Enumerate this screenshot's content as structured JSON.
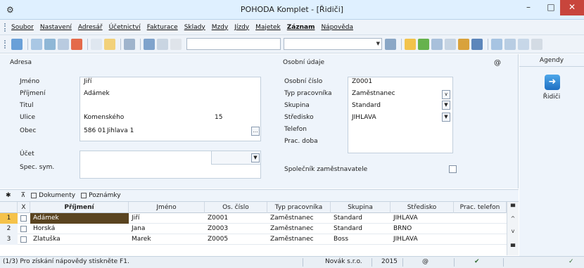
{
  "window": {
    "title": "POHODA Komplet - [Řidiči]",
    "minimize": "–",
    "maximize": "□",
    "close": "✕"
  },
  "menu": [
    "Soubor",
    "Nastavení",
    "Adresář",
    "Účetnictví",
    "Fakturace",
    "Sklady",
    "Mzdy",
    "Jízdy",
    "Majetek",
    "Záznam",
    "Nápověda"
  ],
  "form": {
    "adresa_title": "Adresa",
    "osobni_title": "Osobní údaje",
    "labels": {
      "jmeno": "Jméno",
      "prijmeni": "Příjmení",
      "titul": "Titul",
      "ulice": "Ulice",
      "obec": "Obec",
      "ucet": "Účet",
      "spec_sym": "Spec. sym.",
      "osobni_cislo": "Osobní číslo",
      "typ_pracovnika": "Typ pracovníka",
      "skupina": "Skupina",
      "stredisko": "Středisko",
      "telefon": "Telefon",
      "prac_doba": "Prac. doba",
      "spolecnik": "Společník zaměstnavatele"
    },
    "values": {
      "jmeno": "Jiří",
      "prijmeni": "Adámek",
      "ulice": "Komenského",
      "cislo_popisne": "15",
      "psc": "586 01",
      "obec": "Jihlava 1",
      "osobni_cislo": "Z0001",
      "typ_pracovnika": "Zaměstnanec",
      "skupina": "Standard",
      "stredisko": "JIHLAVA"
    }
  },
  "agenda": {
    "header": "Agendy",
    "item": "Řidiči"
  },
  "tabs": [
    "Dokumenty",
    "Poznámky"
  ],
  "table": {
    "headers": [
      "X",
      "Příjmení",
      "Jméno",
      "Os. číslo",
      "Typ pracovníka",
      "Skupina",
      "Středisko",
      "Prac. telefon"
    ],
    "rows": [
      {
        "num": "1",
        "prijmeni": "Adámek",
        "jmeno": "Jiří",
        "cislo": "Z0001",
        "typ": "Zaměstnanec",
        "skupina": "Standard",
        "stredisko": "JIHLAVA"
      },
      {
        "num": "2",
        "prijmeni": "Horská",
        "jmeno": "Jana",
        "cislo": "Z0003",
        "typ": "Zaměstnanec",
        "skupina": "Standard",
        "stredisko": "BRNO"
      },
      {
        "num": "3",
        "prijmeni": "Zlatuška",
        "jmeno": "Marek",
        "cislo": "Z0005",
        "typ": "Zaměstnanec",
        "skupina": "Boss",
        "stredisko": "JIHLAVA"
      }
    ]
  },
  "status": {
    "hint": "(1/3) Pro získání nápovědy stiskněte F1.",
    "company": "Novák s.r.o.",
    "year": "2015"
  }
}
